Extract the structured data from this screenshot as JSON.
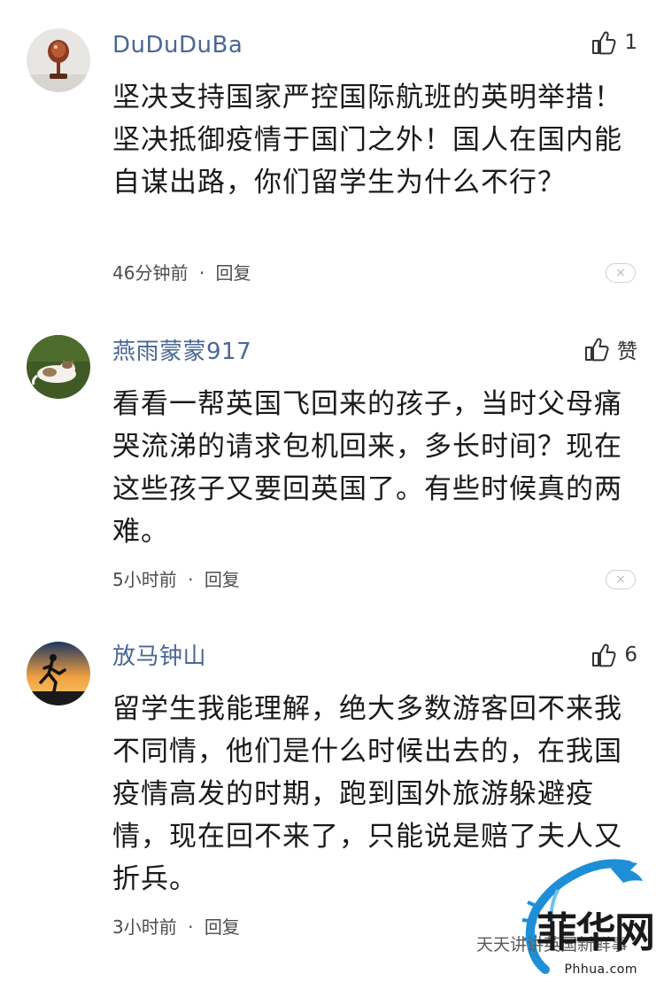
{
  "comments": [
    {
      "username": "DuDuDuBa",
      "likes": "1",
      "text": "坚决支持国家严控国际航班的英明举措！坚决抵御疫情于国门之外！国人在国内能自谋出路，你们留学生为什么不行？",
      "time": "46分钟前",
      "separator": "·",
      "reply": "回复",
      "avatar": "trophy-avatar"
    },
    {
      "username": "燕雨蒙蒙917",
      "likes": "赞",
      "text": "看看一帮英国飞回来的孩子，当时父母痛哭流涕的请求包机回来，多长时间？现在这些孩子又要回英国了。有些时候真的两难。",
      "time": "5小时前",
      "separator": "·",
      "reply": "回复",
      "avatar": "cat-avatar"
    },
    {
      "username": "放马钟山",
      "likes": "6",
      "text": "留学生我能理解，绝大多数游客回不来我不同情，他们是什么时候出去的，在我国疫情高发的时期，跑到国外旅游躲避疫情，现在回不来了，只能说是赔了夫人又折兵。",
      "time": "3小时前",
      "separator": "·",
      "reply": "回复",
      "avatar": "runner-sunset-avatar"
    }
  ],
  "icons": {
    "like": "thumbs-up-icon",
    "close": "close-icon"
  },
  "close_glyph": "×",
  "watermark": {
    "account": "天天讲讲英国新鲜事",
    "brand": "菲华网",
    "site": "Phhua.com"
  },
  "colors": {
    "username": "#4a6794",
    "text": "#1a1a1a",
    "meta": "#4d4d4d",
    "watermark_blue": "#1e8fd6"
  }
}
